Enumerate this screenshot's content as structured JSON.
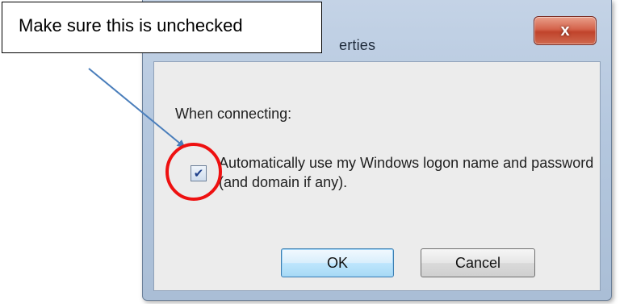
{
  "dialog": {
    "title_visible": "erties",
    "close_label": "x",
    "when_connecting_label": "When connecting:",
    "checkbox": {
      "checked": true,
      "label": "Automatically use my Windows logon name and password (and domain if any)."
    },
    "ok_label": "OK",
    "cancel_label": "Cancel"
  },
  "annotation": {
    "callout_text": "Make sure this is unchecked",
    "arrow_color": "#4a7ebb",
    "circle_color": "#ee1111"
  },
  "colors": {
    "frame": "#b4c7de",
    "client": "#ececec",
    "close_button": "#c0432b",
    "default_button_border": "#3c7fb1"
  }
}
